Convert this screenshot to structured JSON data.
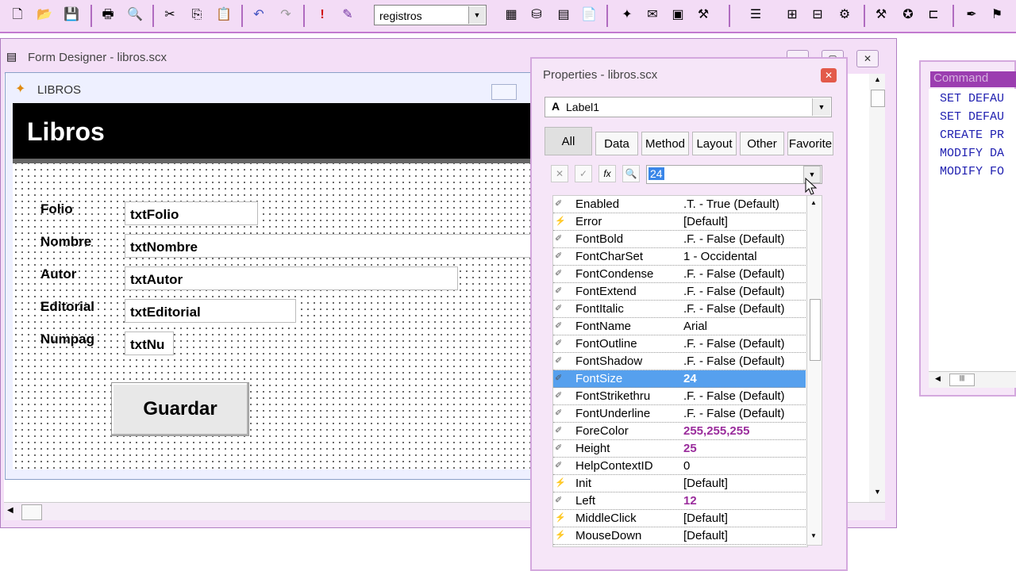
{
  "toolbar": {
    "combo_value": "registros",
    "buttons": [
      "new-icon",
      "open-icon",
      "save-icon",
      "print-icon",
      "print-preview-icon",
      "cut-icon",
      "copy-icon",
      "paste-icon",
      "undo-icon",
      "redo-icon",
      "run-icon",
      "modify-icon",
      "form-icon",
      "report-icon",
      "code-icon",
      "properties-icon",
      "tools-icon",
      "layout-icon",
      "window-icon",
      "gears-icon",
      "palette-icon",
      "align-icon",
      "wizard-icon"
    ]
  },
  "form_designer": {
    "title": "Form Designer - libros.scx",
    "form": {
      "title": "LIBROS",
      "banner": "Libros",
      "fields": [
        {
          "label": "Folio",
          "control": "txtFolio"
        },
        {
          "label": "Nombre",
          "control": "txtNombre"
        },
        {
          "label": "Autor",
          "control": "txtAutor"
        },
        {
          "label": "Editorial",
          "control": "txtEditorial"
        },
        {
          "label": "Numpag",
          "control": "txtNu"
        }
      ],
      "button": "Guardar"
    }
  },
  "properties": {
    "title": "Properties - libros.scx",
    "object": "Label1",
    "tabs": [
      "All",
      "Data",
      "Method",
      "Layout",
      "Other",
      "Favorite"
    ],
    "active_tab": "All",
    "value_box": "24",
    "rows": [
      {
        "name": "Enabled",
        "value": ".T. - True (Default)",
        "icon": "property-icon",
        "modified": false
      },
      {
        "name": "Error",
        "value": "[Default]",
        "icon": "event-icon",
        "modified": false
      },
      {
        "name": "FontBold",
        "value": ".F. - False (Default)",
        "icon": "property-icon",
        "modified": false
      },
      {
        "name": "FontCharSet",
        "value": "1 - Occidental",
        "icon": "property-icon",
        "modified": false
      },
      {
        "name": "FontCondense",
        "value": ".F. - False (Default)",
        "icon": "property-icon",
        "modified": false
      },
      {
        "name": "FontExtend",
        "value": ".F. - False (Default)",
        "icon": "property-icon",
        "modified": false
      },
      {
        "name": "FontItalic",
        "value": ".F. - False (Default)",
        "icon": "property-icon",
        "modified": false
      },
      {
        "name": "FontName",
        "value": "Arial",
        "icon": "property-icon",
        "modified": false
      },
      {
        "name": "FontOutline",
        "value": ".F. - False (Default)",
        "icon": "property-icon",
        "modified": false
      },
      {
        "name": "FontShadow",
        "value": ".F. - False (Default)",
        "icon": "property-icon",
        "modified": false
      },
      {
        "name": "FontSize",
        "value": "24",
        "icon": "property-icon",
        "modified": true,
        "selected": true
      },
      {
        "name": "FontStrikethru",
        "value": ".F. - False (Default)",
        "icon": "property-icon",
        "modified": false
      },
      {
        "name": "FontUnderline",
        "value": ".F. - False (Default)",
        "icon": "property-icon",
        "modified": false
      },
      {
        "name": "ForeColor",
        "value": "255,255,255",
        "icon": "property-icon",
        "modified": true
      },
      {
        "name": "Height",
        "value": "25",
        "icon": "property-icon",
        "modified": true
      },
      {
        "name": "HelpContextID",
        "value": "0",
        "icon": "property-icon",
        "modified": false
      },
      {
        "name": "Init",
        "value": "[Default]",
        "icon": "event-icon",
        "modified": false
      },
      {
        "name": "Left",
        "value": "12",
        "icon": "property-icon",
        "modified": true
      },
      {
        "name": "MiddleClick",
        "value": "[Default]",
        "icon": "event-icon",
        "modified": false
      },
      {
        "name": "MouseDown",
        "value": "[Default]",
        "icon": "event-icon",
        "modified": false
      }
    ]
  },
  "command": {
    "title": "Command",
    "lines": [
      "SET DEFAU",
      "SET DEFAU",
      "CREATE PR",
      "MODIFY DA",
      "MODIFY FO"
    ]
  }
}
